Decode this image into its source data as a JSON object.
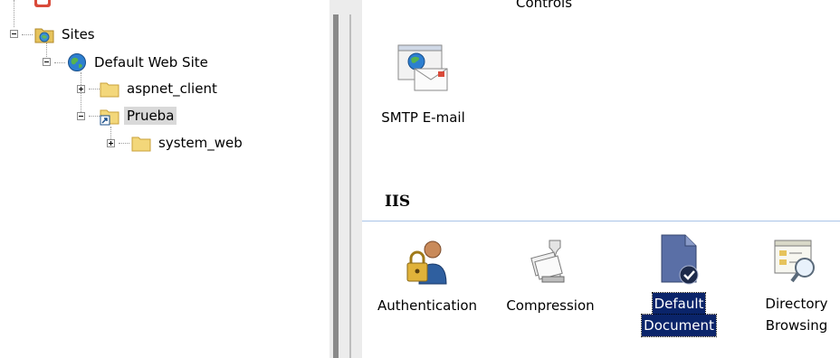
{
  "tree": {
    "sites_label": "Sites",
    "default_site_label": "Default Web Site",
    "aspnet_label": "aspnet_client",
    "prueba_label": "Prueba",
    "systemweb_label": "system_web"
  },
  "content": {
    "top_partial_label": "Controls",
    "smtp_label": "SMTP E-mail",
    "section_title": "IIS",
    "features": [
      {
        "label": "Authentication",
        "icon": "authentication-icon"
      },
      {
        "label": "Compression",
        "icon": "compression-icon"
      },
      {
        "label_line1": "Default",
        "label_line2": "Document",
        "icon": "default-document-icon",
        "selected": true
      },
      {
        "label_line1": "Directory",
        "label_line2": "Browsing",
        "icon": "directory-browsing-icon"
      }
    ]
  },
  "colors": {
    "selection_bg": "#0a246a",
    "tree_selection_bg": "#d9d9d9",
    "section_line": "#a9c4e8"
  }
}
